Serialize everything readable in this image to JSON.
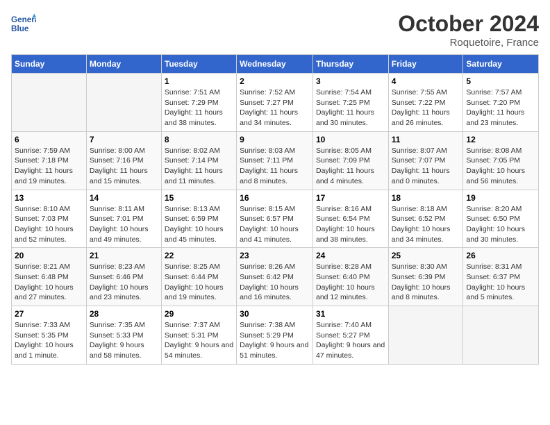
{
  "logo": {
    "text_general": "General",
    "text_blue": "Blue"
  },
  "title": "October 2024",
  "location": "Roquetoire, France",
  "weekdays": [
    "Sunday",
    "Monday",
    "Tuesday",
    "Wednesday",
    "Thursday",
    "Friday",
    "Saturday"
  ],
  "weeks": [
    [
      {
        "day": "",
        "sunrise": "",
        "sunset": "",
        "daylight": ""
      },
      {
        "day": "",
        "sunrise": "",
        "sunset": "",
        "daylight": ""
      },
      {
        "day": "1",
        "sunrise": "Sunrise: 7:51 AM",
        "sunset": "Sunset: 7:29 PM",
        "daylight": "Daylight: 11 hours and 38 minutes."
      },
      {
        "day": "2",
        "sunrise": "Sunrise: 7:52 AM",
        "sunset": "Sunset: 7:27 PM",
        "daylight": "Daylight: 11 hours and 34 minutes."
      },
      {
        "day": "3",
        "sunrise": "Sunrise: 7:54 AM",
        "sunset": "Sunset: 7:25 PM",
        "daylight": "Daylight: 11 hours and 30 minutes."
      },
      {
        "day": "4",
        "sunrise": "Sunrise: 7:55 AM",
        "sunset": "Sunset: 7:22 PM",
        "daylight": "Daylight: 11 hours and 26 minutes."
      },
      {
        "day": "5",
        "sunrise": "Sunrise: 7:57 AM",
        "sunset": "Sunset: 7:20 PM",
        "daylight": "Daylight: 11 hours and 23 minutes."
      }
    ],
    [
      {
        "day": "6",
        "sunrise": "Sunrise: 7:59 AM",
        "sunset": "Sunset: 7:18 PM",
        "daylight": "Daylight: 11 hours and 19 minutes."
      },
      {
        "day": "7",
        "sunrise": "Sunrise: 8:00 AM",
        "sunset": "Sunset: 7:16 PM",
        "daylight": "Daylight: 11 hours and 15 minutes."
      },
      {
        "day": "8",
        "sunrise": "Sunrise: 8:02 AM",
        "sunset": "Sunset: 7:14 PM",
        "daylight": "Daylight: 11 hours and 11 minutes."
      },
      {
        "day": "9",
        "sunrise": "Sunrise: 8:03 AM",
        "sunset": "Sunset: 7:11 PM",
        "daylight": "Daylight: 11 hours and 8 minutes."
      },
      {
        "day": "10",
        "sunrise": "Sunrise: 8:05 AM",
        "sunset": "Sunset: 7:09 PM",
        "daylight": "Daylight: 11 hours and 4 minutes."
      },
      {
        "day": "11",
        "sunrise": "Sunrise: 8:07 AM",
        "sunset": "Sunset: 7:07 PM",
        "daylight": "Daylight: 11 hours and 0 minutes."
      },
      {
        "day": "12",
        "sunrise": "Sunrise: 8:08 AM",
        "sunset": "Sunset: 7:05 PM",
        "daylight": "Daylight: 10 hours and 56 minutes."
      }
    ],
    [
      {
        "day": "13",
        "sunrise": "Sunrise: 8:10 AM",
        "sunset": "Sunset: 7:03 PM",
        "daylight": "Daylight: 10 hours and 52 minutes."
      },
      {
        "day": "14",
        "sunrise": "Sunrise: 8:11 AM",
        "sunset": "Sunset: 7:01 PM",
        "daylight": "Daylight: 10 hours and 49 minutes."
      },
      {
        "day": "15",
        "sunrise": "Sunrise: 8:13 AM",
        "sunset": "Sunset: 6:59 PM",
        "daylight": "Daylight: 10 hours and 45 minutes."
      },
      {
        "day": "16",
        "sunrise": "Sunrise: 8:15 AM",
        "sunset": "Sunset: 6:57 PM",
        "daylight": "Daylight: 10 hours and 41 minutes."
      },
      {
        "day": "17",
        "sunrise": "Sunrise: 8:16 AM",
        "sunset": "Sunset: 6:54 PM",
        "daylight": "Daylight: 10 hours and 38 minutes."
      },
      {
        "day": "18",
        "sunrise": "Sunrise: 8:18 AM",
        "sunset": "Sunset: 6:52 PM",
        "daylight": "Daylight: 10 hours and 34 minutes."
      },
      {
        "day": "19",
        "sunrise": "Sunrise: 8:20 AM",
        "sunset": "Sunset: 6:50 PM",
        "daylight": "Daylight: 10 hours and 30 minutes."
      }
    ],
    [
      {
        "day": "20",
        "sunrise": "Sunrise: 8:21 AM",
        "sunset": "Sunset: 6:48 PM",
        "daylight": "Daylight: 10 hours and 27 minutes."
      },
      {
        "day": "21",
        "sunrise": "Sunrise: 8:23 AM",
        "sunset": "Sunset: 6:46 PM",
        "daylight": "Daylight: 10 hours and 23 minutes."
      },
      {
        "day": "22",
        "sunrise": "Sunrise: 8:25 AM",
        "sunset": "Sunset: 6:44 PM",
        "daylight": "Daylight: 10 hours and 19 minutes."
      },
      {
        "day": "23",
        "sunrise": "Sunrise: 8:26 AM",
        "sunset": "Sunset: 6:42 PM",
        "daylight": "Daylight: 10 hours and 16 minutes."
      },
      {
        "day": "24",
        "sunrise": "Sunrise: 8:28 AM",
        "sunset": "Sunset: 6:40 PM",
        "daylight": "Daylight: 10 hours and 12 minutes."
      },
      {
        "day": "25",
        "sunrise": "Sunrise: 8:30 AM",
        "sunset": "Sunset: 6:39 PM",
        "daylight": "Daylight: 10 hours and 8 minutes."
      },
      {
        "day": "26",
        "sunrise": "Sunrise: 8:31 AM",
        "sunset": "Sunset: 6:37 PM",
        "daylight": "Daylight: 10 hours and 5 minutes."
      }
    ],
    [
      {
        "day": "27",
        "sunrise": "Sunrise: 7:33 AM",
        "sunset": "Sunset: 5:35 PM",
        "daylight": "Daylight: 10 hours and 1 minute."
      },
      {
        "day": "28",
        "sunrise": "Sunrise: 7:35 AM",
        "sunset": "Sunset: 5:33 PM",
        "daylight": "Daylight: 9 hours and 58 minutes."
      },
      {
        "day": "29",
        "sunrise": "Sunrise: 7:37 AM",
        "sunset": "Sunset: 5:31 PM",
        "daylight": "Daylight: 9 hours and 54 minutes."
      },
      {
        "day": "30",
        "sunrise": "Sunrise: 7:38 AM",
        "sunset": "Sunset: 5:29 PM",
        "daylight": "Daylight: 9 hours and 51 minutes."
      },
      {
        "day": "31",
        "sunrise": "Sunrise: 7:40 AM",
        "sunset": "Sunset: 5:27 PM",
        "daylight": "Daylight: 9 hours and 47 minutes."
      },
      {
        "day": "",
        "sunrise": "",
        "sunset": "",
        "daylight": ""
      },
      {
        "day": "",
        "sunrise": "",
        "sunset": "",
        "daylight": ""
      }
    ]
  ]
}
